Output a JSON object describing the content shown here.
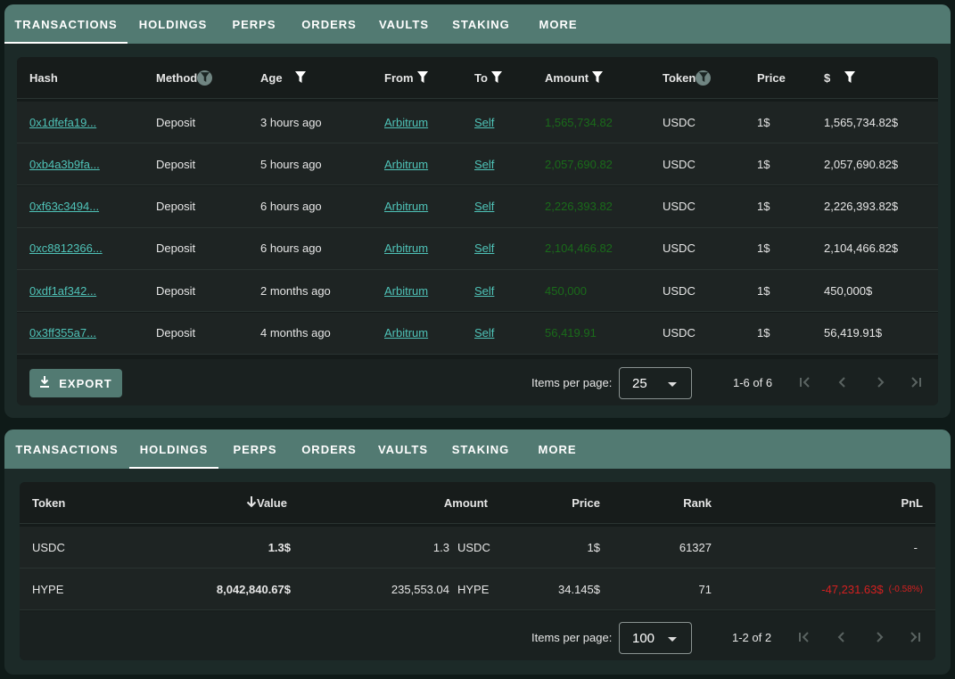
{
  "tabs": [
    "TRANSACTIONS",
    "HOLDINGS",
    "PERPS",
    "ORDERS",
    "VAULTS",
    "STAKING",
    "MORE"
  ],
  "transactions": {
    "active_tab": "TRANSACTIONS",
    "headers": {
      "hash": "Hash",
      "method": "Method",
      "age": "Age",
      "from": "From",
      "to": "To",
      "amount": "Amount",
      "token": "Token",
      "price": "Price",
      "usd": "$"
    },
    "rows": [
      {
        "hash": "0x1dfefa19...",
        "method": "Deposit",
        "age": "3 hours ago",
        "from": "Arbitrum",
        "to": "Self",
        "amount": "1,565,734.82",
        "token": "USDC",
        "price": "1$",
        "usd": "1,565,734.82$"
      },
      {
        "hash": "0xb4a3b9fa...",
        "method": "Deposit",
        "age": "5 hours ago",
        "from": "Arbitrum",
        "to": "Self",
        "amount": "2,057,690.82",
        "token": "USDC",
        "price": "1$",
        "usd": "2,057,690.82$"
      },
      {
        "hash": "0xf63c3494...",
        "method": "Deposit",
        "age": "6 hours ago",
        "from": "Arbitrum",
        "to": "Self",
        "amount": "2,226,393.82",
        "token": "USDC",
        "price": "1$",
        "usd": "2,226,393.82$"
      },
      {
        "hash": "0xc8812366...",
        "method": "Deposit",
        "age": "6 hours ago",
        "from": "Arbitrum",
        "to": "Self",
        "amount": "2,104,466.82",
        "token": "USDC",
        "price": "1$",
        "usd": "2,104,466.82$"
      },
      {
        "hash": "0xdf1af342...",
        "method": "Deposit",
        "age": "2 months ago",
        "from": "Arbitrum",
        "to": "Self",
        "amount": "450,000",
        "token": "USDC",
        "price": "1$",
        "usd": "450,000$"
      },
      {
        "hash": "0x3ff355a7...",
        "method": "Deposit",
        "age": "4 months ago",
        "from": "Arbitrum",
        "to": "Self",
        "amount": "56,419.91",
        "token": "USDC",
        "price": "1$",
        "usd": "56,419.91$"
      }
    ],
    "export_label": "EXPORT",
    "items_per_page_label": "Items per page:",
    "items_per_page": "25",
    "range": "1-6 of 6"
  },
  "holdings": {
    "active_tab": "HOLDINGS",
    "headers": {
      "token": "Token",
      "value": "Value",
      "amount": "Amount",
      "price": "Price",
      "rank": "Rank",
      "pnl": "PnL"
    },
    "rows": [
      {
        "token": "USDC",
        "value": "1.3$",
        "amount": "1.3",
        "amount_token": "USDC",
        "price": "1$",
        "rank": "61327",
        "pnl": "-",
        "pnl_pct": ""
      },
      {
        "token": "HYPE",
        "value": "8,042,840.67$",
        "amount": "235,553.04",
        "amount_token": "HYPE",
        "price": "34.145$",
        "rank": "71",
        "pnl": "-47,231.63$",
        "pnl_pct": "(-0.58%)"
      }
    ],
    "items_per_page_label": "Items per page:",
    "items_per_page": "100",
    "range": "1-2 of 2"
  },
  "colors": {
    "tab_bar": "#527a72",
    "link": "#4fc3b8",
    "amount_green": "#1a6b1a",
    "pnl_red": "#d42020"
  }
}
